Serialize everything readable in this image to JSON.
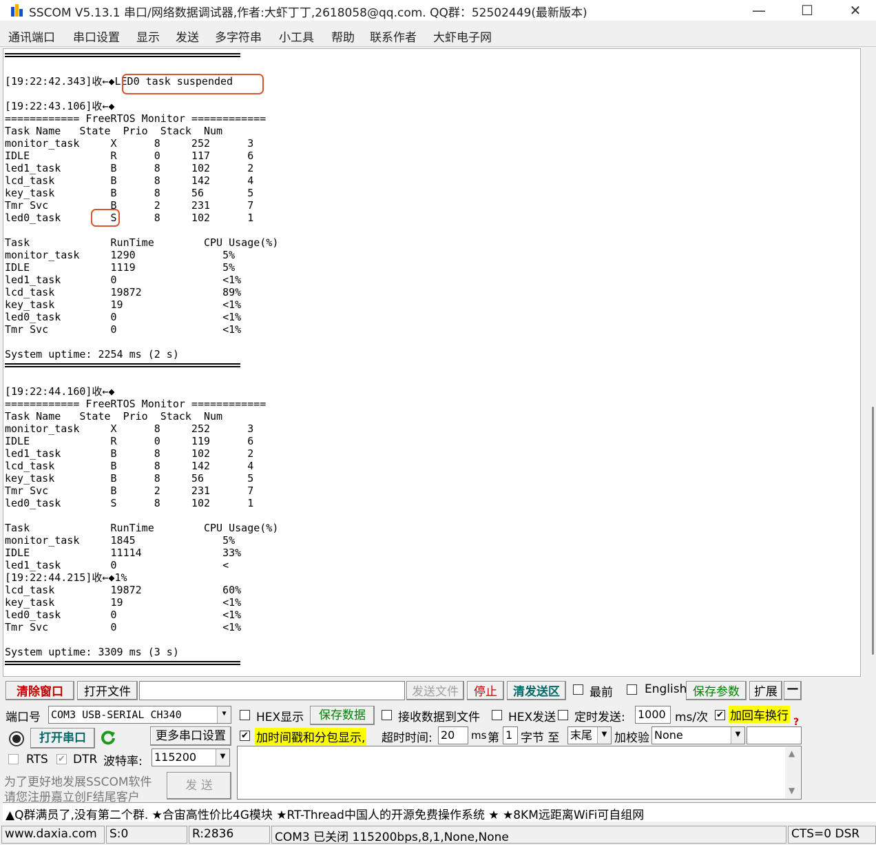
{
  "window": {
    "title": "SSCOM V5.13.1 串口/网络数据调试器,作者:大虾丁丁,2618058@qq.com. QQ群：52502449(最新版本)",
    "min_label": "—",
    "max_label": "☐",
    "close_label": "✕"
  },
  "menu": [
    "通讯端口",
    "串口设置",
    "显示",
    "发送",
    "多字符串",
    "小工具",
    "帮助",
    "联系作者",
    "大虾电子网"
  ],
  "terminal": {
    "lines": [
      "[19:22:42.343]收←◆LED0 task suspended",
      "[19:22:43.106]收←◆",
      "============ FreeRTOS Monitor ============",
      "Task Name   State  Prio  Stack  Num",
      "monitor_task     X      8     252      3",
      "IDLE             R      0     117      6",
      "led1_task        B      8     102      2",
      "lcd_task         B      8     142      4",
      "key_task         B      8     56       5",
      "Tmr Svc          B      2     231      7",
      "led0_task        S      8     102      1",
      "Task             RunTime        CPU Usage(%)",
      "monitor_task     1290              5%",
      "IDLE             1119              5%",
      "led1_task        0                 <1%",
      "lcd_task         19872             89%",
      "key_task         19                <1%",
      "led0_task        0                 <1%",
      "Tmr Svc          0                 <1%",
      "System uptime: 2254 ms (2 s)",
      "[19:22:44.160]收←◆",
      "============ FreeRTOS Monitor ============",
      "Task Name   State  Prio  Stack  Num",
      "monitor_task     X      8     252      3",
      "IDLE             R      0     119      6",
      "led1_task        B      8     102      2",
      "lcd_task         B      8     142      4",
      "key_task         B      8     56       5",
      "Tmr Svc          B      2     231      7",
      "led0_task        S      8     102      1",
      "Task             RunTime        CPU Usage(%)",
      "monitor_task     1845              5%",
      "IDLE             11114             33%",
      "led1_task        0                 <",
      "[19:22:44.215]收←◆1%",
      "lcd_task         19872             60%",
      "key_task         19                <1%",
      "led0_task        0                 <1%",
      "Tmr Svc          0                 <1%",
      "System uptime: 3309 ms (3 s)"
    ]
  },
  "toolbar1": {
    "clear_window": "清除窗口",
    "open_file": "打开文件",
    "send_file": "发送文件",
    "stop": "停止",
    "clear_send": "清发送区",
    "topmost": "最前",
    "english": "English",
    "save_params": "保存参数",
    "expand": "扩展",
    "collapse": "—"
  },
  "port_panel": {
    "port_label": "端口号",
    "port_value": "COM3 USB-SERIAL CH340",
    "open_port": "打开串口",
    "more_settings": "更多串口设置",
    "rts": "RTS",
    "dtr": "DTR",
    "baud_label": "波特率:",
    "baud_value": "115200",
    "promo_line1": "为了更好地发展SSCOM软件",
    "promo_line2": "请您注册嘉立创F结尾客户",
    "send_button": "发 送"
  },
  "options": {
    "hex_display": "HEX显示",
    "save_data": "保存数据",
    "recv_to_file": "接收数据到文件",
    "hex_send": "HEX发送",
    "timed_send": "定时发送:",
    "interval": "1000",
    "interval_unit": "ms/次",
    "add_crlf": "加回车换行",
    "timestamp": "加时间戳和分包显示,",
    "timeout_label": "超时时间:",
    "timeout_value": "20",
    "timeout_unit": "ms",
    "nth_label": "第",
    "nth_value": "1",
    "byte_label": "字节 至",
    "end_value": "末尾",
    "checksum_label": "加校验",
    "checksum_value": "None"
  },
  "ticker": "▲Q群满员了,没有第二个群. ★合宙高性价比4G模块 ★RT-Thread中国人的开源免费操作系统 ★ ★8KM远距离WiFi可自组网",
  "status": {
    "website": "www.daxia.com",
    "sent": "S:0",
    "received": "R:2836",
    "port_state": "COM3 已关闭  115200bps,8,1,None,None",
    "lines_state": "CTS=0 DSR"
  },
  "colors": {
    "highlight_box": "#d9542c",
    "red_button_text": "#c00000",
    "green_text": "#008000",
    "yellow_bg": "#ffff00"
  }
}
